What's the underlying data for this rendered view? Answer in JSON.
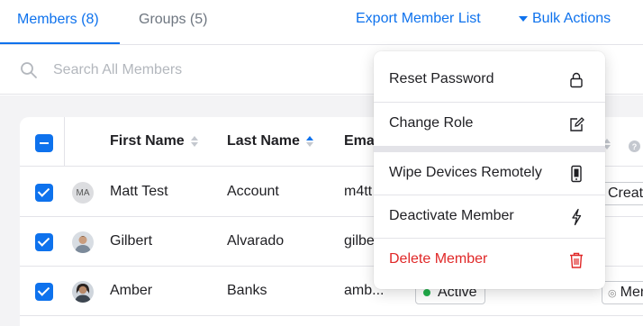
{
  "tabs": {
    "members_label": "Members (8)",
    "groups_label": "Groups (5)"
  },
  "actions": {
    "export_label": "Export Member List",
    "bulk_label": "Bulk Actions"
  },
  "search": {
    "placeholder": "Search All Members",
    "value": ""
  },
  "table": {
    "headers": {
      "first_name": "First Name",
      "last_name": "Last Name",
      "email": "Emai"
    },
    "rows": [
      {
        "first_name": "Matt Test",
        "last_name": "Account",
        "email": "m4tt",
        "avatar_initials": "MA",
        "right_pill": "Creat"
      },
      {
        "first_name": "Gilbert",
        "last_name": "Alvarado",
        "email": "gilbe",
        "right_pill": ""
      },
      {
        "first_name": "Amber",
        "last_name": "Banks",
        "email": "amb...",
        "status": "Active",
        "right_pill": "Mem"
      }
    ]
  },
  "menu": {
    "items": [
      {
        "label": "Reset Password",
        "icon": "lock-icon"
      },
      {
        "label": "Change Role",
        "icon": "edit-icon"
      },
      {
        "label": "Wipe Devices Remotely",
        "icon": "mobile-device-icon"
      },
      {
        "label": "Deactivate Member",
        "icon": "lightning-icon"
      },
      {
        "label": "Delete Member",
        "icon": "trash-icon"
      }
    ]
  },
  "colors": {
    "accent": "#0e72ed",
    "danger": "#e02828",
    "active_status": "#22b14c"
  }
}
